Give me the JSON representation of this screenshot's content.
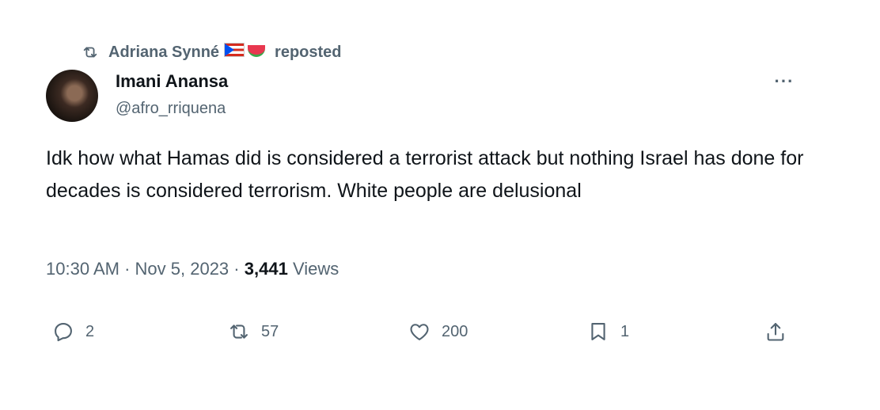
{
  "repost": {
    "reposter_name": "Adriana Synné",
    "action_text": "reposted",
    "icons": [
      "repost-icon",
      "puerto-rico-flag-icon",
      "watermelon-icon"
    ]
  },
  "author": {
    "name": "Imani Anansa",
    "handle": "@afro_rriquena"
  },
  "tweet": {
    "text": "Idk how what Hamas did is considered a terrorist attack but nothing Israel has done for decades is considered terrorism. White people are delusional"
  },
  "meta": {
    "time": "10:30 AM",
    "separator": "·",
    "date": "Nov 5, 2023",
    "views_count": "3,441",
    "views_label": "Views"
  },
  "actions": {
    "replies": "2",
    "reposts": "57",
    "likes": "200",
    "bookmarks": "1"
  },
  "colors": {
    "text_primary": "#0f1419",
    "text_secondary": "#536471",
    "background": "#ffffff"
  }
}
